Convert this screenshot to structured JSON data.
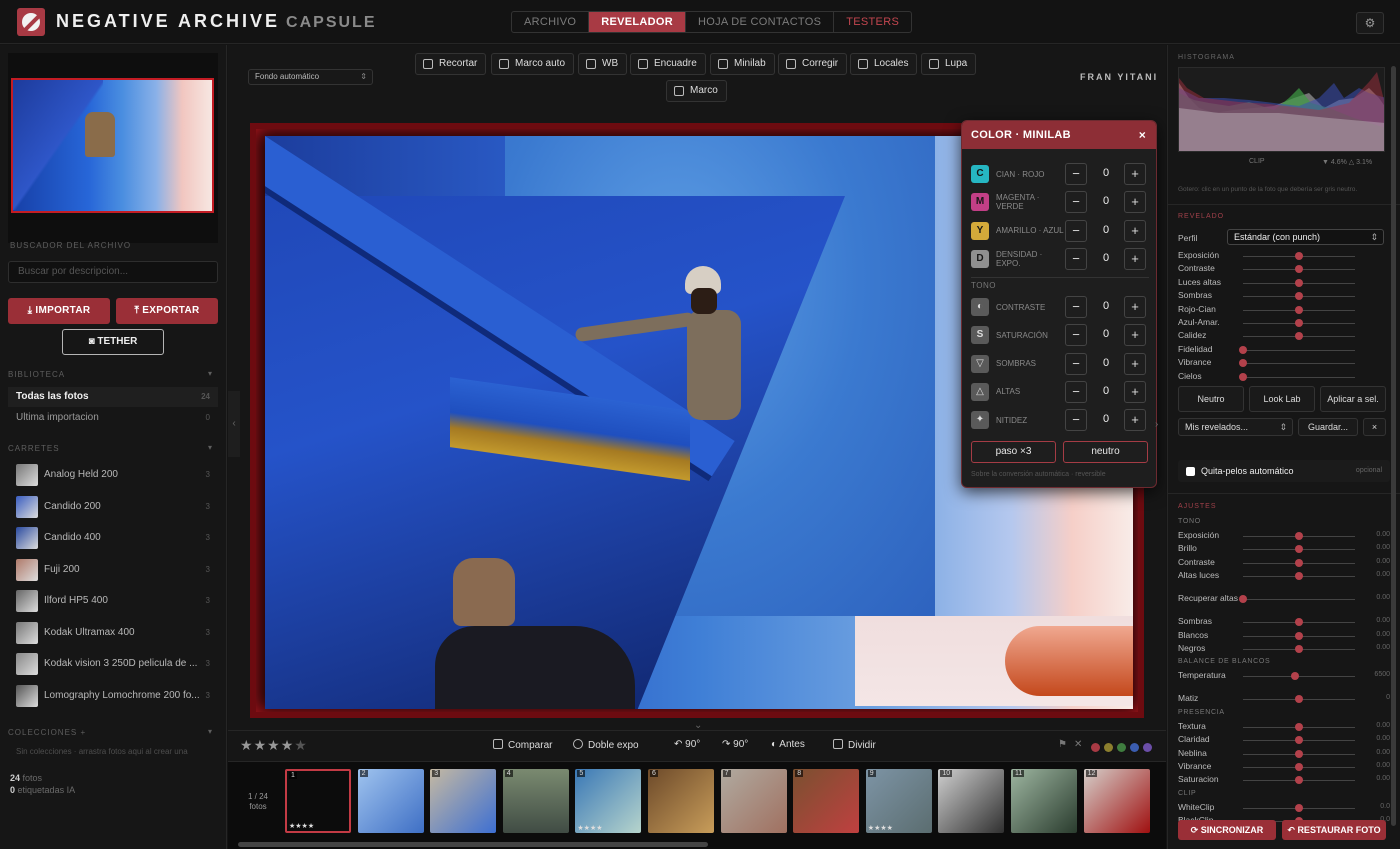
{
  "brand": {
    "name": "NEGATIVE ARCHIVE",
    "sub": "CAPSULE"
  },
  "nav": {
    "tabs": [
      "ARCHIVO",
      "REVELADOR",
      "HOJA DE CONTACTOS",
      "TESTERS"
    ],
    "active": "REVELADOR",
    "settings_icon": "gear-icon"
  },
  "sidebar": {
    "search_label": "BUSCADOR DEL ARCHIVO",
    "search_placeholder": "Buscar por descripcion...",
    "import_label": "IMPORTAR",
    "export_label": "EXPORTAR",
    "tether_label": "TETHER",
    "library_label": "BIBLIOTECA",
    "library_items": [
      {
        "label": "Todas las fotos",
        "count": "24"
      },
      {
        "label": "Ultima importacion",
        "count": "0"
      }
    ],
    "rolls_label": "CARRETES",
    "rolls": [
      {
        "name": "Analog Held 200",
        "count": "3"
      },
      {
        "name": "Candido 200",
        "count": "3"
      },
      {
        "name": "Candido 400",
        "count": "3"
      },
      {
        "name": "Fuji 200",
        "count": "3"
      },
      {
        "name": "Ilford HP5 400",
        "count": "3"
      },
      {
        "name": "Kodak Ultramax 400",
        "count": "3"
      },
      {
        "name": "Kodak vision 3 250D pelicula de ...",
        "count": "3"
      },
      {
        "name": "Lomography Lomochrome 200 fo...",
        "count": "3"
      }
    ],
    "collections_label": "COLECCIONES",
    "collections_add": "+",
    "collections_empty": "Sin colecciones · arrastra fotos aqui al crear una",
    "stats": {
      "photos": "24",
      "photos_label": "fotos",
      "tagged": "0",
      "tagged_label": "etiquetadas IA"
    }
  },
  "toolbar": {
    "fondo": "Fondo automático",
    "tools": [
      "Recortar",
      "Marco auto",
      "WB",
      "Encuadre",
      "Minilab",
      "Corregir",
      "Locales",
      "Lupa",
      "Marco"
    ],
    "author": "FRAN YITANI"
  },
  "minilab": {
    "title": "COLOR · MINILAB",
    "close": "×",
    "color_rows": [
      {
        "badge": "C",
        "label": "CIAN · ROJO",
        "value": "0",
        "color": "#26b6c2"
      },
      {
        "badge": "M",
        "label": "MAGENTA · VERDE",
        "value": "0",
        "color": "#c23f86"
      },
      {
        "badge": "Y",
        "label": "AMARILLO · AZUL",
        "value": "0",
        "color": "#d3a93a"
      },
      {
        "badge": "D",
        "label": "DENSIDAD · EXPO.",
        "value": "0",
        "color": "#8f8f8f"
      }
    ],
    "tone_label": "TONO",
    "tone_rows": [
      {
        "badge": "◐",
        "label": "CONTRASTE",
        "value": "0"
      },
      {
        "badge": "S",
        "label": "SATURACIÓN",
        "value": "0"
      },
      {
        "badge": "▽",
        "label": "SOMBRAS",
        "value": "0"
      },
      {
        "badge": "△",
        "label": "ALTAS",
        "value": "0"
      },
      {
        "badge": "✦",
        "label": "NITIDEZ",
        "value": "0"
      }
    ],
    "minus": "−",
    "plus": "+",
    "step_label": "paso ×3",
    "neutral_label": "neutro",
    "note": "Sobre la conversión automática · reversible"
  },
  "actions": {
    "rating": 4,
    "compare": "Comparar",
    "double": "Doble expo",
    "rot_left": "90°",
    "rot_right": "90°",
    "before": "Antes",
    "split": "Dividir",
    "color_dots": [
      "#a83a44",
      "#8c7f2e",
      "#3f7d3f",
      "#3b5db0",
      "#6b4ea8"
    ]
  },
  "filmstrip": {
    "position": "1 / 24",
    "unit": "fotos",
    "frames": [
      {
        "num": "1",
        "stars": "★★★★"
      },
      {
        "num": "2",
        "stars": ""
      },
      {
        "num": "3",
        "stars": ""
      },
      {
        "num": "4",
        "stars": ""
      },
      {
        "num": "5",
        "stars": "★★★★"
      },
      {
        "num": "6",
        "stars": ""
      },
      {
        "num": "7",
        "stars": ""
      },
      {
        "num": "8",
        "stars": ""
      },
      {
        "num": "9",
        "stars": "★★★★"
      },
      {
        "num": "10",
        "stars": ""
      },
      {
        "num": "11",
        "stars": ""
      },
      {
        "num": "12",
        "stars": ""
      }
    ]
  },
  "right": {
    "histogram_label": "HISTOGRAMA",
    "clip_label": "CLIP",
    "clip_value": "▼ 4.6% △ 3.1%",
    "hint": "Gotero: clic en un punto de la foto que debería ser gris neutro.",
    "revelado_label": "REVELADO",
    "perfil_label": "Perfil",
    "perfil_value": "Estándar (con punch)",
    "revelado_sliders": [
      {
        "label": "Exposición",
        "value": 0.5
      },
      {
        "label": "Contraste",
        "value": 0.5
      },
      {
        "label": "Luces altas",
        "value": 0.5
      },
      {
        "label": "Sombras",
        "value": 0.5
      },
      {
        "label": "Rojo-Cian",
        "value": 0.5
      },
      {
        "label": "Azul-Amar.",
        "value": 0.5
      },
      {
        "label": "Calidez",
        "value": 0.5
      },
      {
        "label": "Fidelidad",
        "value": 0.0
      },
      {
        "label": "Vibrance",
        "value": 0.0
      },
      {
        "label": "Cielos",
        "value": 0.0
      }
    ],
    "btn_neutral": "Neutro",
    "btn_look": "Look Lab",
    "btn_apply": "Aplicar a sel.",
    "mis_revelados": "Mis revelados...",
    "guardar": "Guardar...",
    "x": "×",
    "quita_pelos": "Quita-pelos automático",
    "opcional": "opcional",
    "ajustes_label": "AJUSTES",
    "groups": [
      {
        "title": "TONO",
        "items": [
          {
            "label": "Exposición",
            "value": 0.5,
            "text": "0.00"
          },
          {
            "label": "Brillo",
            "value": 0.5,
            "text": "0.00"
          },
          {
            "label": "Contraste",
            "value": 0.5,
            "text": "0.00"
          },
          {
            "label": "Altas luces",
            "value": 0.5,
            "text": "0.00"
          },
          {
            "label": "Recuperar altas",
            "value": 0.0,
            "text": "0.00"
          },
          {
            "label": "Sombras",
            "value": 0.5,
            "text": "0.00"
          },
          {
            "label": "Blancos",
            "value": 0.5,
            "text": "0.00"
          },
          {
            "label": "Negros",
            "value": 0.5,
            "text": "0.00"
          }
        ]
      },
      {
        "title": "BALANCE DE BLANCOS",
        "items": [
          {
            "label": "Temperatura",
            "value": 0.46,
            "text": "6500"
          },
          {
            "label": "Matiz",
            "value": 0.5,
            "text": "0"
          }
        ]
      },
      {
        "title": "PRESENCIA",
        "items": [
          {
            "label": "Textura",
            "value": 0.5,
            "text": "0.00"
          },
          {
            "label": "Claridad",
            "value": 0.5,
            "text": "0.00"
          },
          {
            "label": "Neblina",
            "value": 0.5,
            "text": "0.00"
          },
          {
            "label": "Vibrance",
            "value": 0.5,
            "text": "0.00"
          },
          {
            "label": "Saturacion",
            "value": 0.5,
            "text": "0.00"
          }
        ]
      },
      {
        "title": "CLIP",
        "items": [
          {
            "label": "WhiteClip",
            "value": 0.5,
            "text": "0.0"
          },
          {
            "label": "BlackClip",
            "value": 0.5,
            "text": "0.0"
          }
        ]
      }
    ],
    "sync_label": "SINCRONIZAR",
    "restore_label": "RESTAURAR FOTO"
  }
}
